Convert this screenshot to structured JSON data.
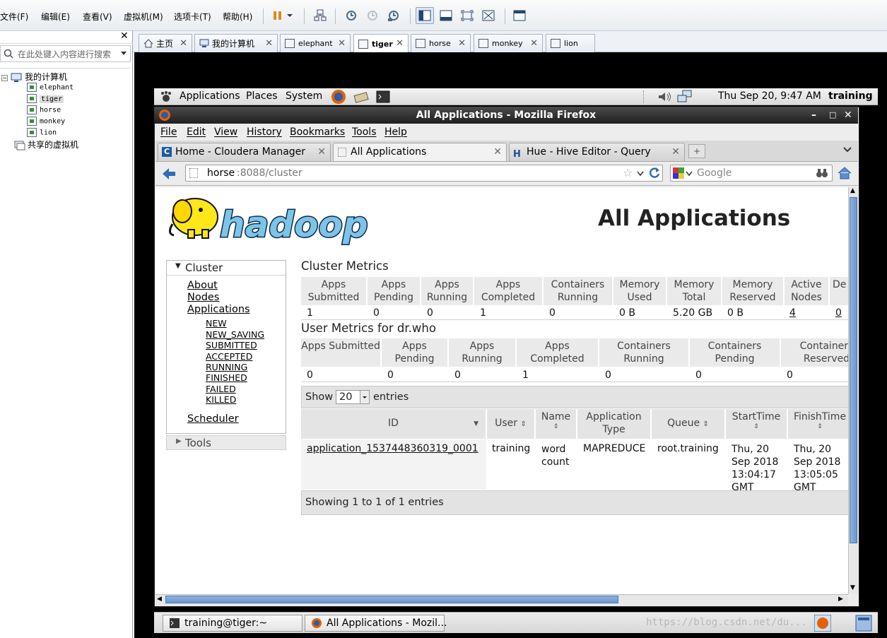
{
  "vmware": {
    "menu": [
      "文件(F)",
      "编辑(E)",
      "查看(V)",
      "虚拟机(M)",
      "选项卡(T)",
      "帮助(H)"
    ],
    "library": {
      "search_placeholder": "在此处键入内容进行搜索",
      "root": "我的计算机",
      "vms": [
        "elephant",
        "tiger",
        "horse",
        "monkey",
        "lion"
      ],
      "shared": "共享的虚拟机"
    },
    "tabs": [
      "主页",
      "我的计算机",
      "elephant",
      "tiger",
      "horse",
      "monkey",
      "lion"
    ],
    "active_tab": "tiger"
  },
  "gnome": {
    "menus": [
      "Applications",
      "Places",
      "System"
    ],
    "clock": "Thu Sep 20,  9:47 AM",
    "user": "training"
  },
  "firefox": {
    "title": "All Applications - Mozilla Firefox",
    "menu": [
      "File",
      "Edit",
      "View",
      "History",
      "Bookmarks",
      "Tools",
      "Help"
    ],
    "tabs": [
      "Home - Cloudera Manager",
      "All Applications",
      "Hue - Hive Editor - Query"
    ],
    "url_host": "horse",
    "url_path": ":8088/cluster",
    "search_placeholder": "Google"
  },
  "page": {
    "logo_text": "hadoop",
    "heading": "All Applications",
    "nav": {
      "cluster": "Cluster",
      "links": [
        "About",
        "Nodes",
        "Applications"
      ],
      "states": [
        "NEW",
        "NEW_SAVING",
        "SUBMITTED",
        "ACCEPTED",
        "RUNNING",
        "FINISHED",
        "FAILED",
        "KILLED"
      ],
      "scheduler": "Scheduler",
      "tools": "Tools"
    },
    "cluster_metrics": {
      "title": "Cluster Metrics",
      "headers": [
        "Apps Submitted",
        "Apps Pending",
        "Apps Running",
        "Apps Completed",
        "Containers Running",
        "Memory Used",
        "Memory Total",
        "Memory Reserved",
        "Active Nodes",
        "De"
      ],
      "values": [
        "1",
        "0",
        "0",
        "1",
        "0",
        "0 B",
        "5.20 GB",
        "0 B",
        "4",
        "0"
      ]
    },
    "user_metrics": {
      "title": "User Metrics for dr.who",
      "headers": [
        "Apps Submitted",
        "Apps Pending",
        "Apps Running",
        "Apps Completed",
        "Containers Running",
        "Containers Pending",
        "Containers Reserved"
      ],
      "values": [
        "0",
        "0",
        "0",
        "1",
        "0",
        "0",
        "0"
      ]
    },
    "show_label": "Show",
    "show_value": "20",
    "entries_label": "entries",
    "apps_table": {
      "headers": [
        "ID",
        "User",
        "Name",
        "Application Type",
        "Queue",
        "StartTime",
        "FinishTime"
      ],
      "rows": [
        {
          "id": "application_1537448360319_0001",
          "user": "training",
          "name": "word count",
          "type": "MAPREDUCE",
          "queue": "root.training",
          "start": "Thu, 20 Sep 2018 13:04:17 GMT",
          "finish": "Thu, 20 Sep 2018 13:05:05 GMT"
        }
      ]
    },
    "footer": "Showing 1 to 1 of 1 entries"
  },
  "taskbar": [
    "training@tiger:~",
    "All Applications - Mozil..."
  ],
  "watermark": "https://blog.csdn.net/du..."
}
